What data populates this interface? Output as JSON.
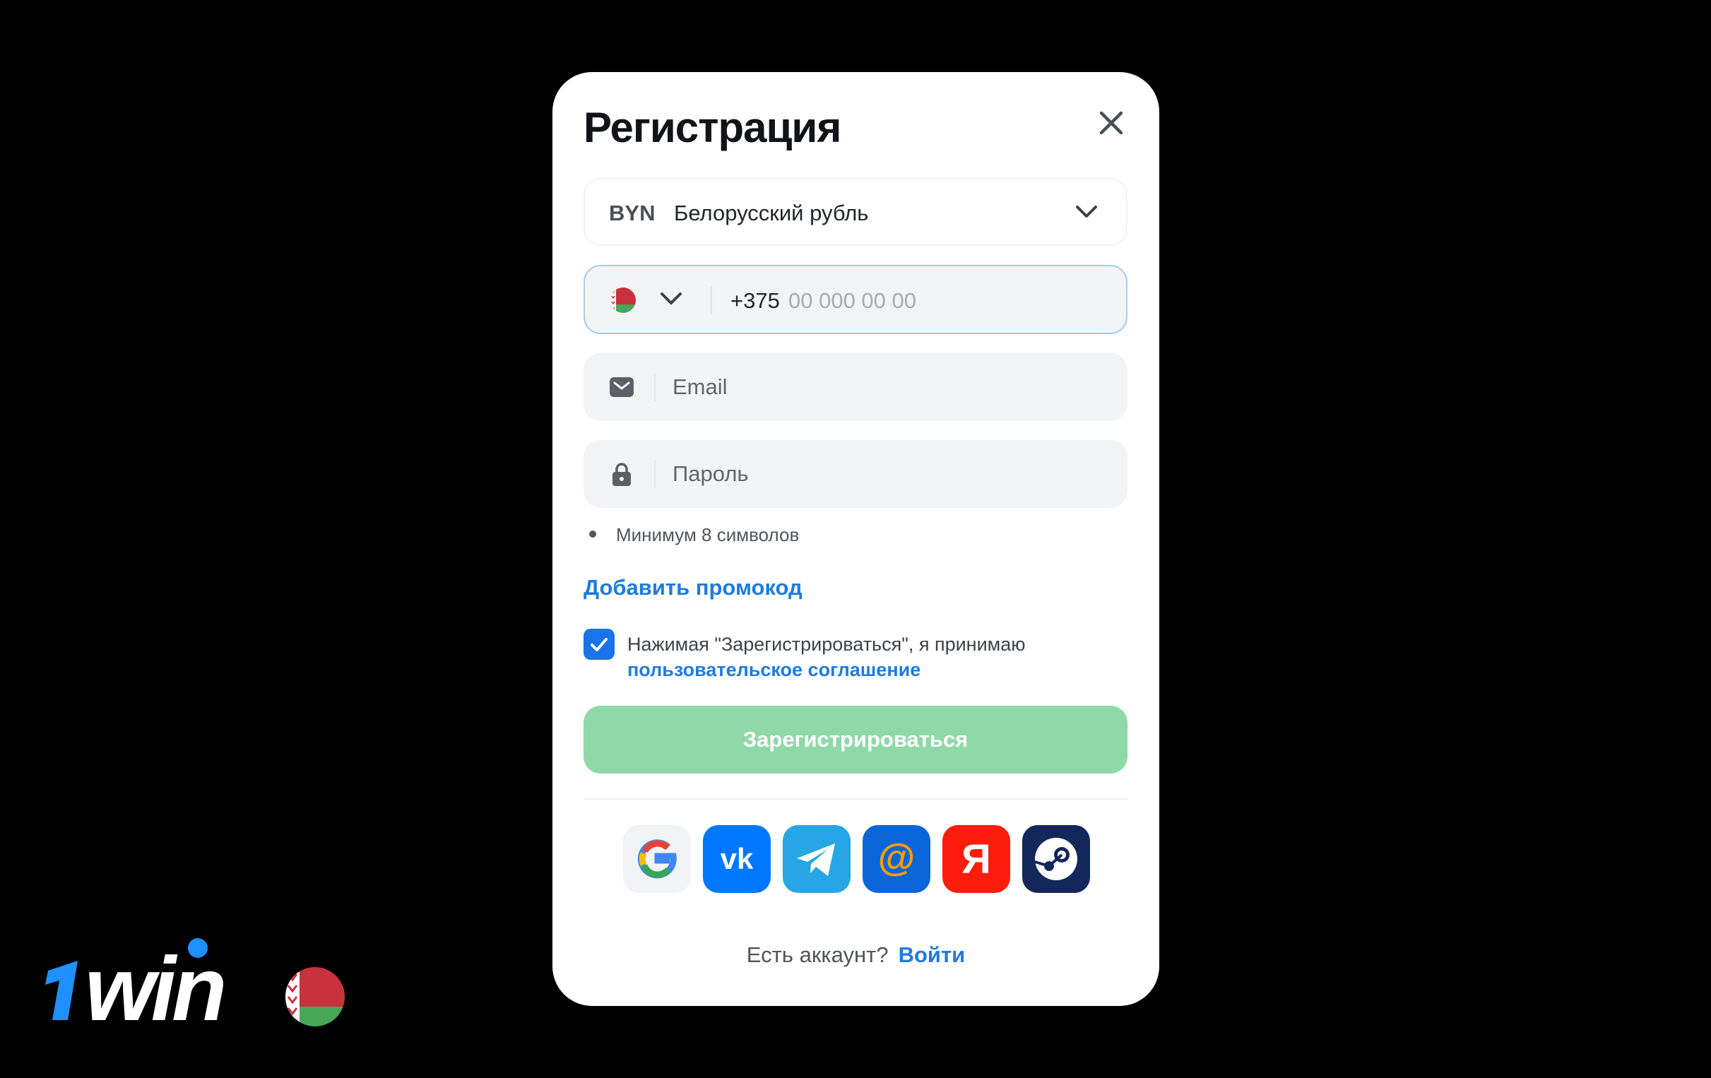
{
  "modal": {
    "title": "Регистрация",
    "currency": {
      "code": "BYN",
      "name": "Белорусский рубль"
    },
    "phone": {
      "country": "Belarus",
      "prefix": "+375",
      "placeholder": "00 000 00 00"
    },
    "email": {
      "placeholder": "Email"
    },
    "password": {
      "placeholder": "Пароль",
      "hint": "Минимум 8 символов"
    },
    "promo_link": "Добавить промокод",
    "agreement": {
      "checked": true,
      "text": "Нажимая \"Зарегистрироваться\", я принимаю",
      "link": "пользовательское соглашение"
    },
    "submit_label": "Зарегистрироваться",
    "social_logins": [
      "google-icon",
      "vk-icon",
      "telegram-icon",
      "mailru-icon",
      "yandex-icon",
      "steam-icon"
    ],
    "footer": {
      "question": "Есть аккаунт?",
      "login_link": "Войти"
    }
  },
  "logo": {
    "text": "1win"
  },
  "colors": {
    "accent": "#1e7be0",
    "submit_disabled": "#8fd9a8",
    "checkbox": "#1a73e8"
  }
}
